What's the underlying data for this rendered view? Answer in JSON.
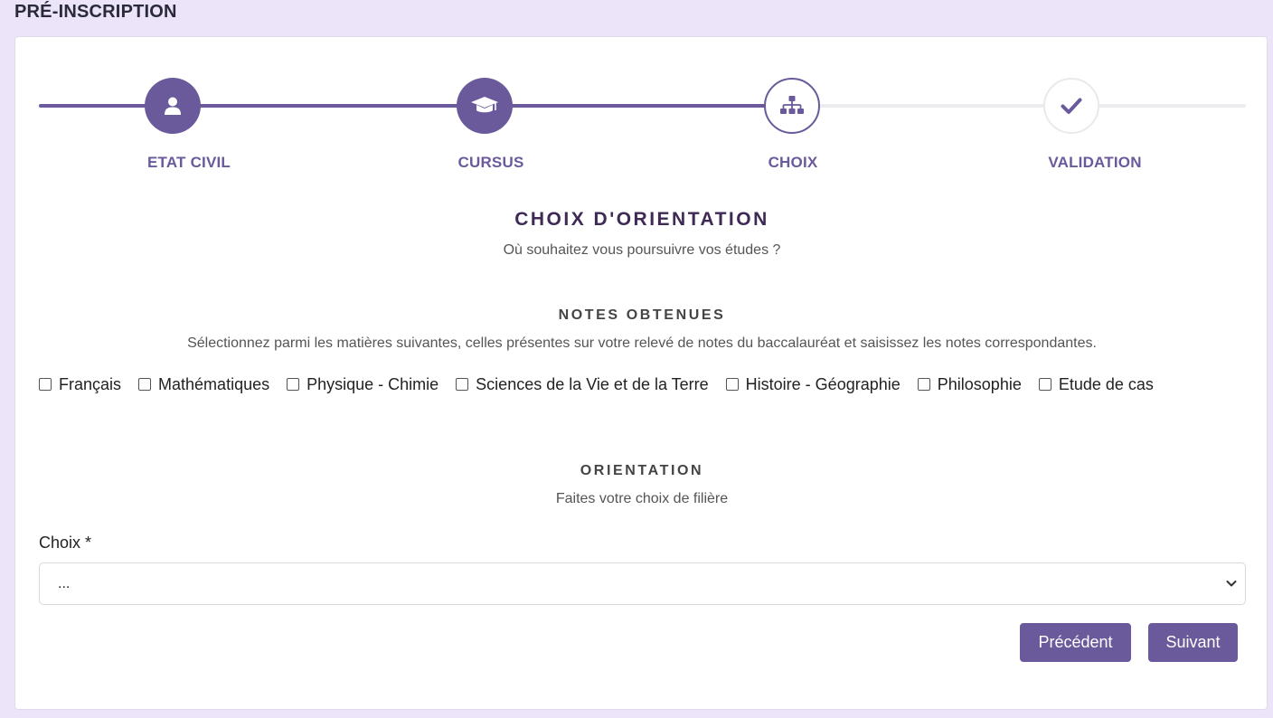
{
  "page": {
    "title": "PRÉ-INSCRIPTION"
  },
  "stepper": {
    "steps": [
      {
        "label": "ETAT CIVIL",
        "icon": "user-icon",
        "state": "done"
      },
      {
        "label": "CURSUS",
        "icon": "graduation-cap-icon",
        "state": "done"
      },
      {
        "label": "CHOIX",
        "icon": "sitemap-icon",
        "state": "current"
      },
      {
        "label": "VALIDATION",
        "icon": "check-icon",
        "state": "todo"
      }
    ]
  },
  "main": {
    "title": "CHOIX D'ORIENTATION",
    "subtitle": "Où souhaitez vous poursuivre vos études ?"
  },
  "notes": {
    "title": "NOTES OBTENUES",
    "description": "Sélectionnez parmi les matières suivantes, celles présentes sur votre relevé de notes du baccalauréat et saisissez les notes correspondantes.",
    "subjects": [
      {
        "label": "Français",
        "checked": false
      },
      {
        "label": "Mathématiques",
        "checked": false
      },
      {
        "label": "Physique - Chimie",
        "checked": false
      },
      {
        "label": "Sciences de la Vie et de la Terre",
        "checked": false
      },
      {
        "label": "Histoire - Géographie",
        "checked": false
      },
      {
        "label": "Philosophie",
        "checked": false
      },
      {
        "label": "Etude de cas",
        "checked": false
      }
    ]
  },
  "orientation": {
    "title": "ORIENTATION",
    "description": "Faites votre choix de filière",
    "field_label": "Choix *",
    "selected_value": "..."
  },
  "buttons": {
    "previous": "Précédent",
    "next": "Suivant"
  },
  "colors": {
    "accent": "#6a5a9c",
    "background": "#ece4f8",
    "heading": "#3e2a55"
  }
}
